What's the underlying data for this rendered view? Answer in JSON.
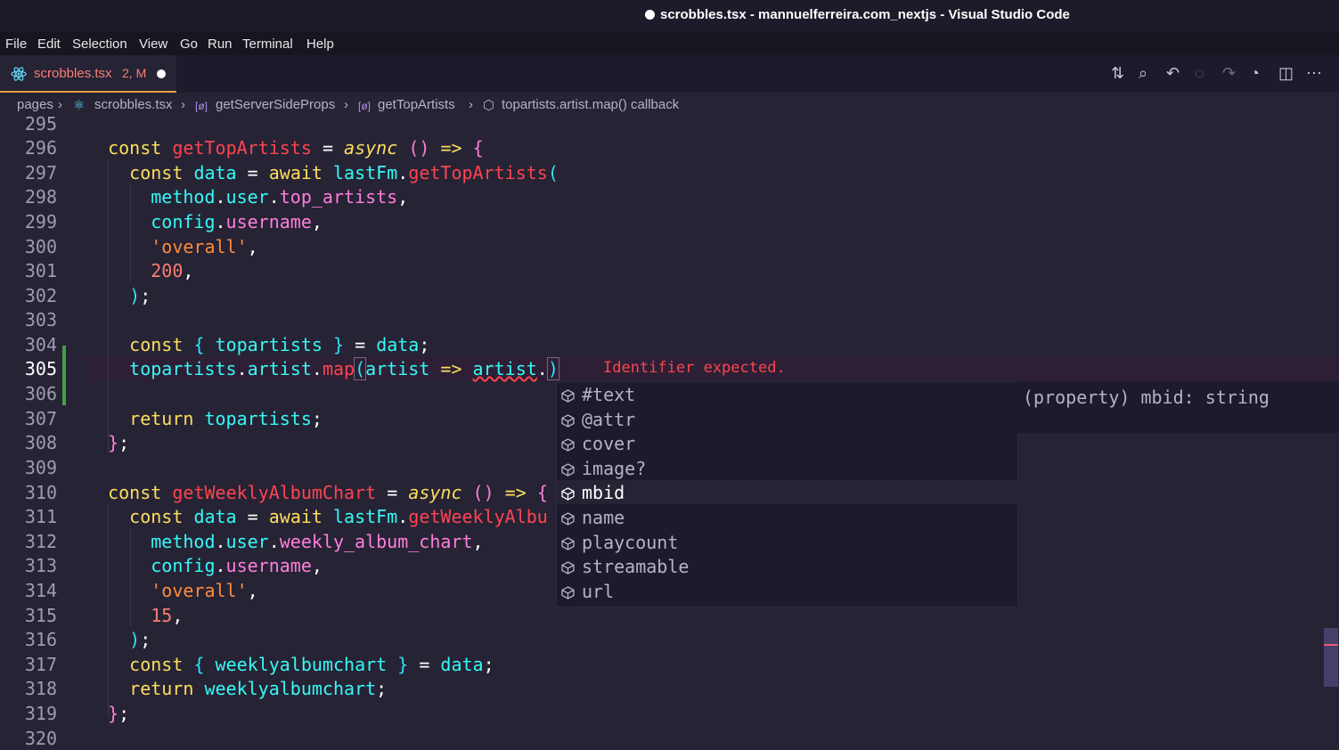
{
  "window": {
    "title": "scrobbles.tsx - mannuelferreira.com_nextjs - Visual Studio Code"
  },
  "menu": [
    "File",
    "Edit",
    "Selection",
    "View",
    "Go",
    "Run",
    "Terminal",
    "Help"
  ],
  "tab": {
    "filename": "scrobbles.tsx",
    "badge": "2, M",
    "icon": "react-icon",
    "modified": true
  },
  "actions": [
    "source-control-icon",
    "search-icon",
    "go-back-icon",
    "breakpoint-icon",
    "go-forward-icon",
    "timeline-icon",
    "split-editor-icon",
    "more-icon"
  ],
  "breadcrumb": {
    "items": [
      "pages",
      "scrobbles.tsx",
      "getServerSideProps",
      "getTopArtists",
      "topartists.artist.map() callback"
    ]
  },
  "editor": {
    "line_numbers": [
      "295",
      "296",
      "297",
      "298",
      "299",
      "300",
      "301",
      "302",
      "303",
      "304",
      "305",
      "306",
      "307",
      "308",
      "309",
      "310",
      "311",
      "312",
      "313",
      "314",
      "315",
      "316",
      "317",
      "318",
      "319",
      "320"
    ],
    "active_line": "305",
    "error_message": "Identifier expected.",
    "colors": {
      "background": "#262335",
      "keyword": "#fede5d",
      "function": "#fe4450",
      "identifier": "#ff7edb",
      "string": "#ff8b39",
      "number": "#f97e72",
      "accent": "#36f9f6"
    }
  },
  "suggest": {
    "items": [
      "#text",
      "@attr",
      "cover",
      "image?",
      "mbid",
      "name",
      "playcount",
      "streamable",
      "url"
    ],
    "selected": "mbid",
    "item_icon": "property-cube-icon",
    "detail": "(property) mbid: string"
  }
}
